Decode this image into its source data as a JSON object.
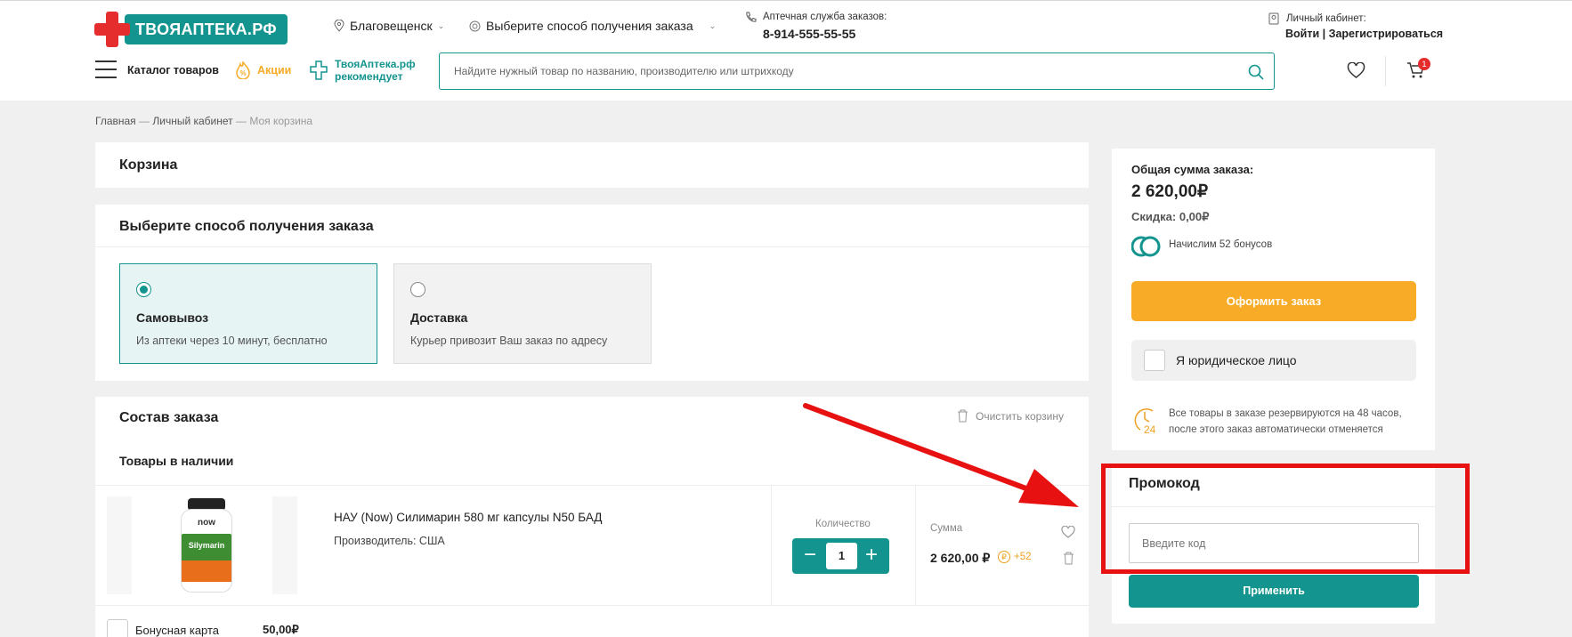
{
  "header": {
    "logo_text": "ТВОЯАПТЕКА.РФ",
    "city": "Благовещенск",
    "delivery_choice": "Выберите способ получения заказа",
    "phone_caption": "Аптечная служба заказов:",
    "phone": "8-914-555-55-55",
    "account_caption": "Личный кабинет:",
    "login": "Войти",
    "separator": "|",
    "register": "Зарегистрироваться",
    "catalog": "Каталог товаров",
    "promo": "Акции",
    "recommend_line1": "ТвояАптека.рф",
    "recommend_line2": "рекомендует",
    "search_placeholder": "Найдите нужный товар по названию, производителю или штрихкоду",
    "cart_count": "1"
  },
  "breadcrumb": {
    "home": "Главная",
    "sep": "—",
    "account": "Личный кабинет",
    "current": "Моя корзина"
  },
  "cart_title": "Корзина",
  "delivery": {
    "title": "Выберите способ получения заказа",
    "options": [
      {
        "title": "Самовывоз",
        "desc": "Из аптеки через 10 минут, бесплатно",
        "selected": true
      },
      {
        "title": "Доставка",
        "desc": "Курьер привозит Ваш заказ по адресу",
        "selected": false
      }
    ]
  },
  "order": {
    "title": "Состав заказа",
    "clear": "Очистить корзину",
    "in_stock": "Товары в наличии",
    "item": {
      "image_label": "Silymarin",
      "name": "НАУ (Now) Силимарин 580 мг капсулы N50 БАД",
      "maker": "Производитель: США",
      "qty_label": "Количество",
      "qty": "1",
      "sum_label": "Сумма",
      "sum": "2 620,00 ₽",
      "bonus": "+52"
    },
    "bonus_card_label": "Бонусная карта",
    "bonus_card_value": "50,00₽"
  },
  "summary": {
    "total_label": "Общая сумма заказа:",
    "total": "2 620,00₽",
    "discount_label": "Скидка:",
    "discount": "0,00₽",
    "bonus_text": "Начислим 52 бонусов",
    "checkout": "Оформить заказ",
    "legal": "Я юридическое лицо",
    "reserve_text": "Все товары в заказе резервируются на 48 часов, после этого заказ автоматически отменяется"
  },
  "promo": {
    "title": "Промокод",
    "placeholder": "Введите код",
    "apply": "Применить"
  },
  "colors": {
    "accent": "#13948f",
    "orange": "#f8ab26",
    "annotation": "#e81111"
  }
}
